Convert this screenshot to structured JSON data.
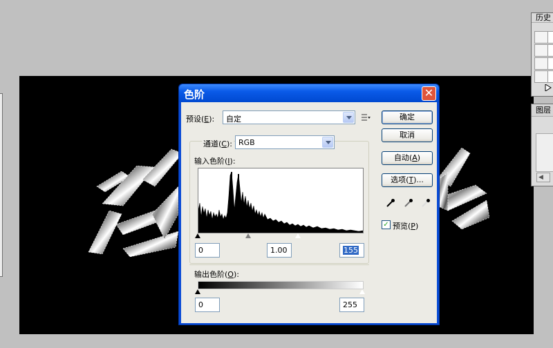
{
  "dialog": {
    "title": "色阶",
    "close_icon": "close-icon",
    "preset_label": "预设",
    "preset_key": "E",
    "preset_value": "自定",
    "channel_label": "通道",
    "channel_key": "C",
    "channel_value": "RGB",
    "input_levels_label": "输入色阶",
    "input_levels_key": "I",
    "input_black": "0",
    "input_gamma": "1.00",
    "input_white": "155",
    "output_levels_label": "输出色阶",
    "output_levels_key": "O",
    "output_black": "0",
    "output_white": "255",
    "buttons": {
      "ok": "确定",
      "cancel": "取消",
      "auto": "自动",
      "auto_key": "A",
      "options": "选项",
      "options_key": "T",
      "options_suffix": "..."
    },
    "preview_label": "预览",
    "preview_key": "P",
    "preview_checked": true
  },
  "panels": {
    "history_title": "历史",
    "layers_title": "图层"
  },
  "colors": {
    "titlebar": "#0a5ae8",
    "client": "#ecebe5",
    "close": "#e0553b"
  }
}
